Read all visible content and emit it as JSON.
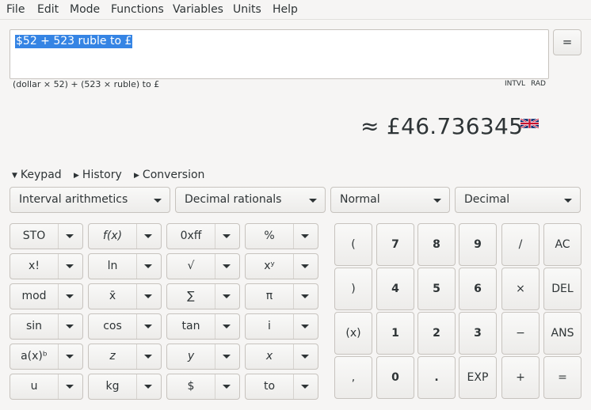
{
  "menu": [
    "File",
    "Edit",
    "Mode",
    "Functions",
    "Variables",
    "Units",
    "Help"
  ],
  "expression": "$52 + 523 ruble to £",
  "equals_button": "=",
  "parsed": "(dollar × 52) + (523 × ruble) to £",
  "status": {
    "interval": "INTVL",
    "angle": "RAD"
  },
  "result": "≈ £46.736345",
  "result_flag_icon": "uk-flag-icon",
  "toggles": [
    "Keypad",
    "History",
    "Conversion"
  ],
  "combos": [
    "Interval arithmetics",
    "Decimal rationals",
    "Normal",
    "Decimal"
  ],
  "functions": [
    [
      "STO",
      "f(x)",
      "0xff",
      "%"
    ],
    [
      "x!",
      "ln",
      "√",
      "xʸ"
    ],
    [
      "mod",
      "x̄",
      "∑",
      "π"
    ],
    [
      "sin",
      "cos",
      "tan",
      "i"
    ],
    [
      "a(x)ᵇ",
      "z",
      "y",
      "x"
    ],
    [
      "u",
      "kg",
      "$",
      "to"
    ]
  ],
  "keypad": [
    [
      "(",
      "7",
      "8",
      "9",
      "/",
      "AC"
    ],
    [
      ")",
      "4",
      "5",
      "6",
      "×",
      "DEL"
    ],
    [
      "(x)",
      "1",
      "2",
      "3",
      "−",
      "ANS"
    ],
    [
      ",",
      "0",
      ".",
      "EXP",
      "+",
      "="
    ]
  ]
}
